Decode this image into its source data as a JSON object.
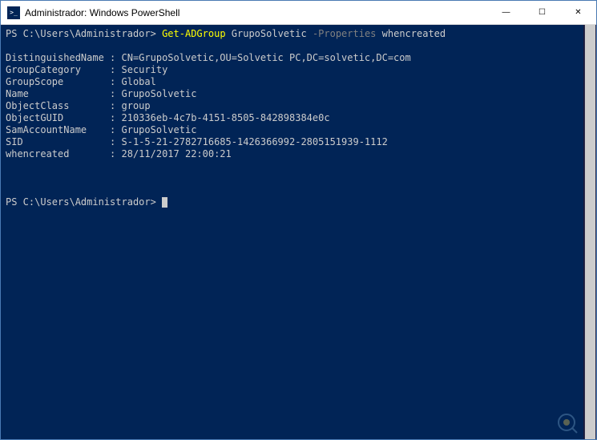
{
  "window": {
    "title": "Administrador: Windows PowerShell"
  },
  "controls": {
    "minimize": "—",
    "maximize": "☐",
    "close": "✕"
  },
  "prompt1": {
    "path": "PS C:\\Users\\Administrador> ",
    "cmdlet": "Get-ADGroup",
    "arg": " GrupoSolvetic ",
    "param": "-Properties",
    "value": " whencreated"
  },
  "output": [
    "",
    "DistinguishedName : CN=GrupoSolvetic,OU=Solvetic PC,DC=solvetic,DC=com",
    "GroupCategory     : Security",
    "GroupScope        : Global",
    "Name              : GrupoSolvetic",
    "ObjectClass       : group",
    "ObjectGUID        : 210336eb-4c7b-4151-8505-842898384e0c",
    "SamAccountName    : GrupoSolvetic",
    "SID               : S-1-5-21-2782716685-1426366992-2805151939-1112",
    "whencreated       : 28/11/2017 22:00:21",
    "",
    "",
    ""
  ],
  "prompt2": {
    "path": "PS C:\\Users\\Administrador> "
  }
}
